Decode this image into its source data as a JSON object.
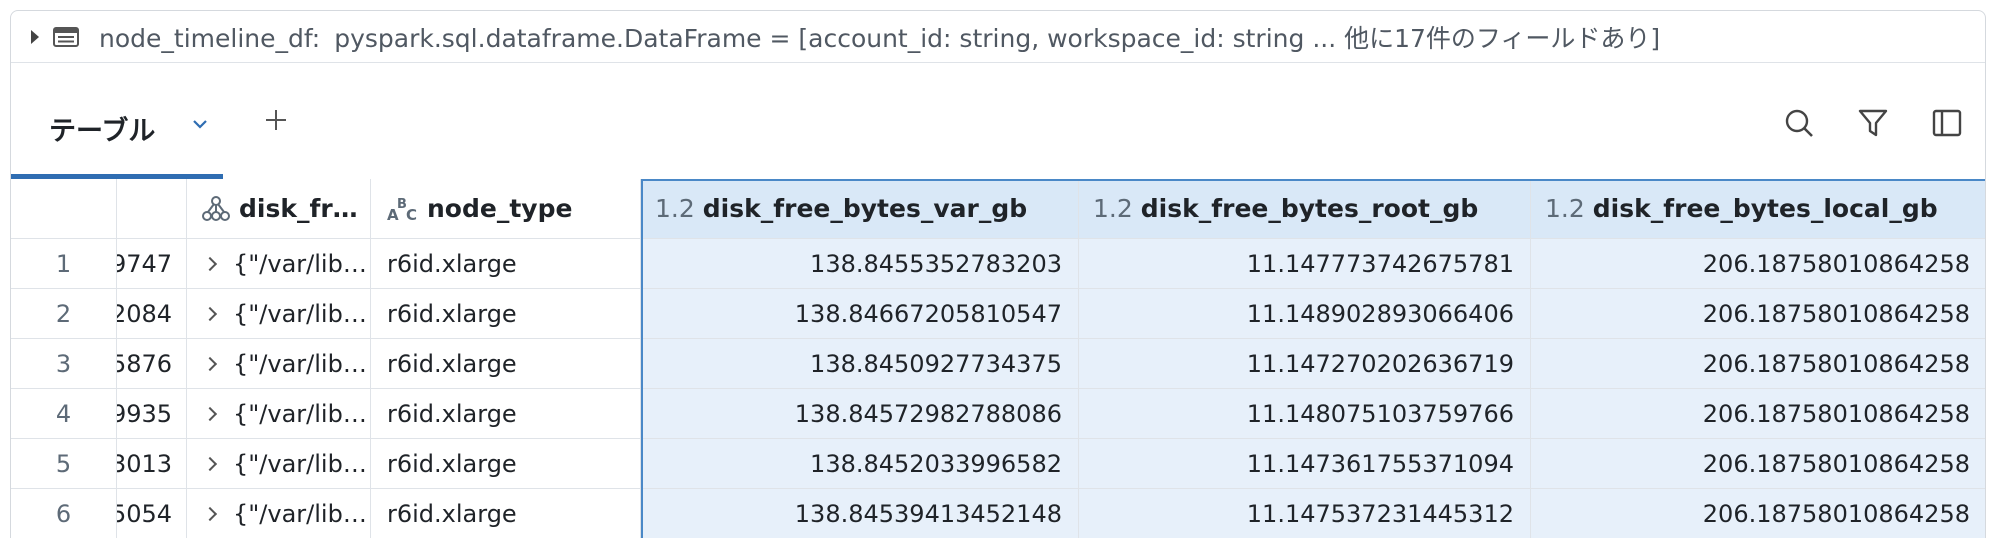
{
  "variable_bar": {
    "name": "node_timeline_df:",
    "type_text": "pyspark.sql.dataframe.DataFrame = [account_id: string, workspace_id: string ... 他に17件のフィールドあり]"
  },
  "tabs": {
    "active_label": "テーブル"
  },
  "icons": {
    "expand": "caret-right-icon",
    "dataframe": "table-icon",
    "tab_menu": "chevron-down-icon",
    "add_tab": "plus-icon",
    "search": "search-icon",
    "filter": "filter-icon",
    "sidebar": "panel-icon",
    "struct": "struct-tree-icon",
    "string": "string-abc-icon"
  },
  "colors": {
    "accent": "#2f6db2",
    "selection": "#e7f0fa",
    "selection_border": "#4a88c7"
  },
  "table": {
    "columns": [
      {
        "label": "",
        "type": ""
      },
      {
        "label": "",
        "type": ""
      },
      {
        "label": "disk_fr…",
        "type": "struct"
      },
      {
        "label": "node_type",
        "type": "ABC"
      },
      {
        "label": "disk_free_bytes_var_gb",
        "type": "1.2"
      },
      {
        "label": "disk_free_bytes_root_gb",
        "type": "1.2"
      },
      {
        "label": "disk_free_bytes_local_gb",
        "type": "1.2"
      }
    ],
    "rows": [
      {
        "n": "1",
        "id": "9747",
        "disk": "{\"/var/lib…",
        "node_type": "r6id.xlarge",
        "var": "138.8455352783203",
        "root": "11.147773742675781",
        "local": "206.18758010864258"
      },
      {
        "n": "2",
        "id": "2084",
        "disk": "{\"/var/lib…",
        "node_type": "r6id.xlarge",
        "var": "138.84667205810547",
        "root": "11.148902893066406",
        "local": "206.18758010864258"
      },
      {
        "n": "3",
        "id": "5876",
        "disk": "{\"/var/lib…",
        "node_type": "r6id.xlarge",
        "var": "138.8450927734375",
        "root": "11.147270202636719",
        "local": "206.18758010864258"
      },
      {
        "n": "4",
        "id": "9935",
        "disk": "{\"/var/lib…",
        "node_type": "r6id.xlarge",
        "var": "138.84572982788086",
        "root": "11.148075103759766",
        "local": "206.18758010864258"
      },
      {
        "n": "5",
        "id": "3013",
        "disk": "{\"/var/lib…",
        "node_type": "r6id.xlarge",
        "var": "138.8452033996582",
        "root": "11.147361755371094",
        "local": "206.18758010864258"
      },
      {
        "n": "6",
        "id": "5054",
        "disk": "{\"/var/lib…",
        "node_type": "r6id.xlarge",
        "var": "138.84539413452148",
        "root": "11.147537231445312",
        "local": "206.18758010864258"
      }
    ]
  }
}
